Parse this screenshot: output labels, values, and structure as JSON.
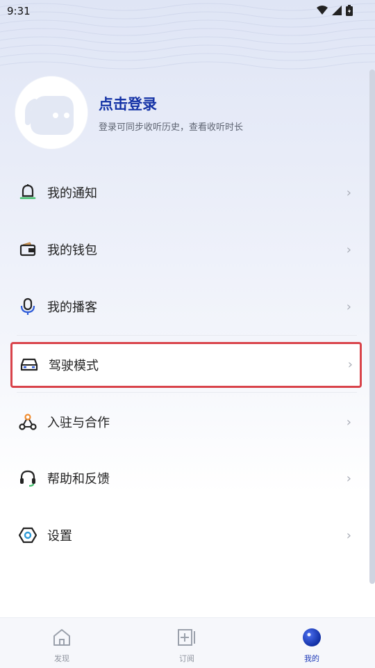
{
  "status_bar": {
    "time": "9:31"
  },
  "profile": {
    "title": "点击登录",
    "subtitle": "登录可同步收听历史，查看收听时长"
  },
  "menu": {
    "items": [
      {
        "label": "我的通知",
        "icon": "bell-icon"
      },
      {
        "label": "我的钱包",
        "icon": "wallet-icon"
      },
      {
        "label": "我的播客",
        "icon": "microphone-icon"
      },
      {
        "label": "驾驶模式",
        "icon": "car-icon"
      },
      {
        "label": "入驻与合作",
        "icon": "network-icon"
      },
      {
        "label": "帮助和反馈",
        "icon": "headset-icon"
      },
      {
        "label": "设置",
        "icon": "gear-icon"
      }
    ]
  },
  "tab_bar": {
    "tabs": [
      {
        "label": "发现",
        "icon": "home-icon"
      },
      {
        "label": "订阅",
        "icon": "subscribe-icon"
      },
      {
        "label": "我的",
        "icon": "profile-orb-icon"
      }
    ],
    "active": "我的"
  },
  "colors": {
    "accent": "#1533a6",
    "highlight_border": "#d9434a"
  }
}
